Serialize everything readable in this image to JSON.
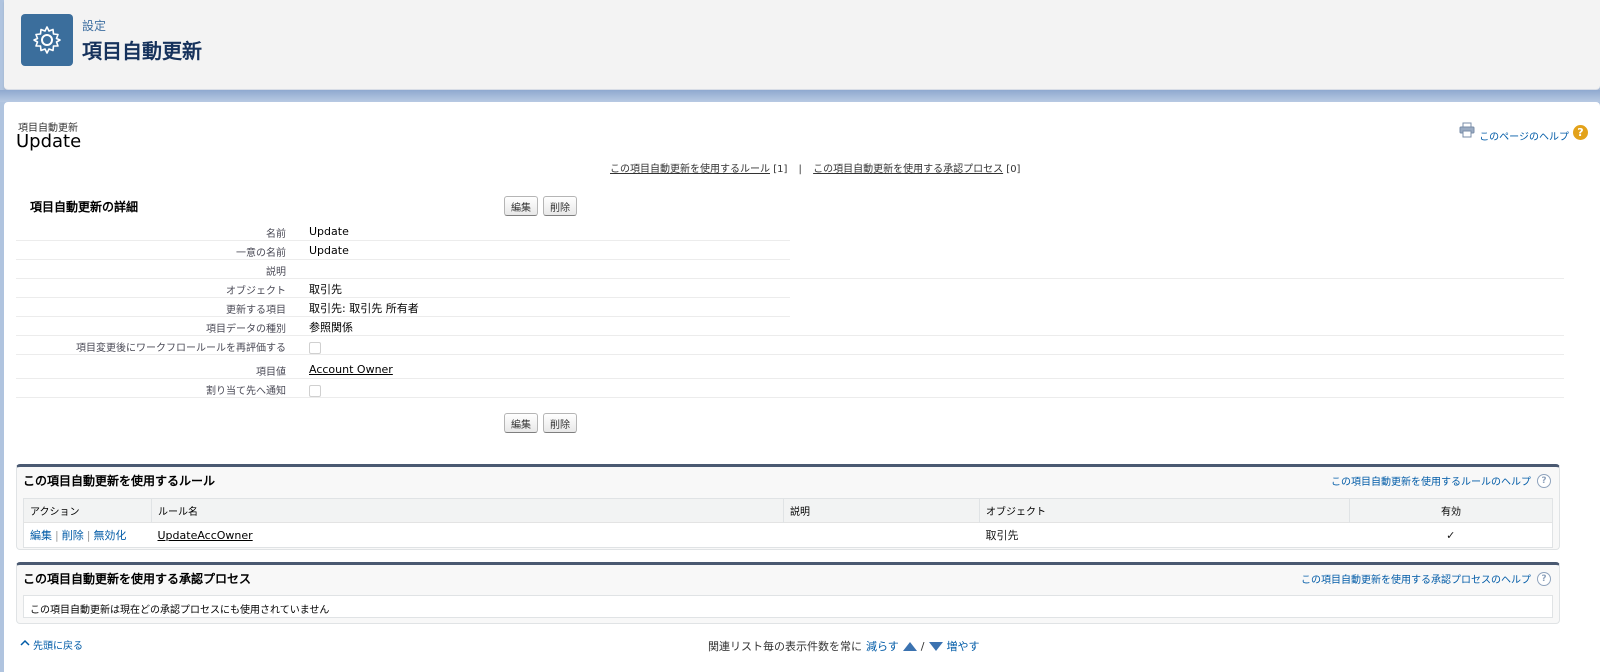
{
  "header": {
    "breadcrumb": "設定",
    "title": "項目自動更新",
    "icon": "gear-icon"
  },
  "page": {
    "type_label": "項目自動更新",
    "name": "Update",
    "help_link": "このページのヘルプ",
    "links": [
      {
        "label": "この項目自動更新を使用するルール",
        "count": "[1]"
      },
      {
        "label": "この項目自動更新を使用する承認プロセス",
        "count": "[0]"
      }
    ],
    "link_separator": "|"
  },
  "detail": {
    "title": "項目自動更新の詳細",
    "edit_button": "編集",
    "delete_button": "削除",
    "fields": {
      "name_label": "名前",
      "name_value": "Update",
      "unique_name_label": "一意の名前",
      "unique_name_value": "Update",
      "description_label": "説明",
      "description_value": "",
      "object_label": "オブジェクト",
      "object_value": "取引先",
      "field_label": "更新する項目",
      "field_value": "取引先: 取引先 所有者",
      "data_type_label": "項目データの種別",
      "data_type_value": "参照関係",
      "reevaluate_label": "項目変更後にワークフロールールを再評価する",
      "field_value_label": "項目値",
      "field_value_value": "Account Owner",
      "notify_label": "割り当て先へ通知"
    }
  },
  "rules_list": {
    "title": "この項目自動更新を使用するルール",
    "help": "この項目自動更新を使用するルールのヘルプ",
    "columns": {
      "action": "アクション",
      "rule_name": "ルール名",
      "description": "説明",
      "object": "オブジェクト",
      "active": "有効"
    },
    "row": {
      "edit": "編集",
      "delete": "削除",
      "deactivate": "無効化",
      "rule_name": "UpdateAccOwner",
      "description": "",
      "object": "取引先",
      "active_mark": "✓"
    }
  },
  "approval_list": {
    "title": "この項目自動更新を使用する承認プロセス",
    "help": "この項目自動更新を使用する承認プロセスのヘルプ",
    "empty_message": "この項目自動更新は現在どの承認プロセスにも使用されていません"
  },
  "footer": {
    "back_to_top": "先頭に戻る",
    "prefix": "関連リスト毎の表示件数を常に",
    "fewer": "減らす",
    "slash": "/",
    "more": "増やす"
  },
  "colors": {
    "header_icon_bg": "#3b6e9c",
    "link": "#015ba7",
    "background_band": "#b0c4df"
  }
}
